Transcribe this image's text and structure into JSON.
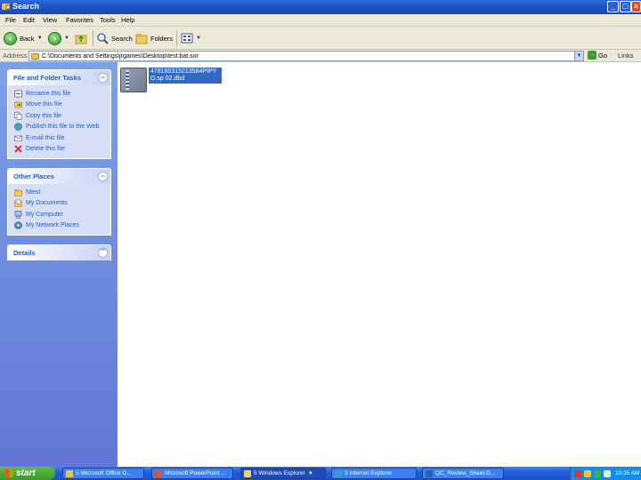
{
  "window": {
    "title": "Search"
  },
  "menu": [
    "File",
    "Edit",
    "View",
    "Favorites",
    "Tools",
    "Help"
  ],
  "toolbar": {
    "back_label": "Back",
    "search_label": "Search",
    "folders_label": "Folders"
  },
  "address": {
    "label": "Address",
    "value": "C:\\Documents and Settings\\jrgaines\\Desktop\\test.bat.sor",
    "go_label": "Go",
    "links_label": "Links"
  },
  "panels": {
    "file_tasks": {
      "title": "File and Folder Tasks",
      "items": [
        {
          "label": "Rename this file",
          "icon": "rename-icon"
        },
        {
          "label": "Move this file",
          "icon": "move-icon"
        },
        {
          "label": "Copy this file",
          "icon": "copy-icon"
        },
        {
          "label": "Publish this file to the Web",
          "icon": "globe-icon"
        },
        {
          "label": "E-mail this file",
          "icon": "email-icon"
        },
        {
          "label": "Delete this file",
          "icon": "delete-icon"
        }
      ]
    },
    "other_places": {
      "title": "Other Places",
      "items": [
        {
          "label": "Ntest",
          "icon": "folder-icon"
        },
        {
          "label": "My Documents",
          "icon": "documents-icon"
        },
        {
          "label": "My Computer",
          "icon": "computer-icon"
        },
        {
          "label": "My Network Places",
          "icon": "network-icon"
        }
      ]
    },
    "details": {
      "title": "Details"
    }
  },
  "file": {
    "name": "478160315213584PIPYO.sp 02.dbd"
  },
  "taskbar": {
    "start_label": "start",
    "buttons": [
      {
        "label": "5 Microsoft Office O..."
      },
      {
        "label": "Microsoft PowerPoint ..."
      },
      {
        "label": "5 Windows Explorer"
      },
      {
        "label": "3 Internet Explorer"
      },
      {
        "label": "QC_Review_Sheet.D..."
      }
    ],
    "clock": "10:35 AM"
  },
  "colors": {
    "title_bar": "#1c54c8",
    "task_pane": "#6375d6",
    "link_text": "#215dc6",
    "selection": "#316ac5",
    "start_button": "#3a9a2a"
  }
}
